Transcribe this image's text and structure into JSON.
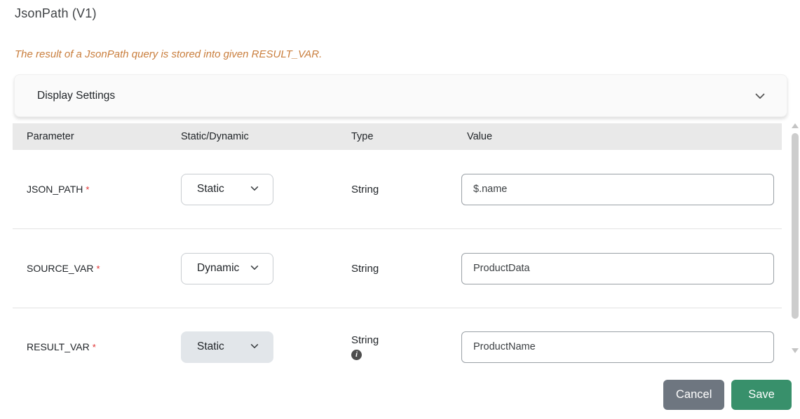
{
  "page": {
    "title": "JsonPath (V1)",
    "description": "The result of a JsonPath query is stored into given RESULT_VAR."
  },
  "display_settings": {
    "label": "Display Settings",
    "chevron_icon": "chevron-down"
  },
  "table": {
    "headers": {
      "parameter": "Parameter",
      "static_dynamic": "Static/Dynamic",
      "type": "Type",
      "value": "Value"
    },
    "rows": [
      {
        "parameter": "JSON_PATH",
        "required": "*",
        "static_dynamic": "Static",
        "type": "String",
        "value": "$.name"
      },
      {
        "parameter": "SOURCE_VAR",
        "required": "*",
        "static_dynamic": "Dynamic",
        "type": "String",
        "value": "ProductData"
      },
      {
        "parameter": "RESULT_VAR",
        "required": "*",
        "static_dynamic": "Static",
        "type": "String",
        "value": "ProductName",
        "info_icon": "info-circle"
      }
    ]
  },
  "footer": {
    "cancel_label": "Cancel",
    "save_label": "Save"
  },
  "colors": {
    "description_text": "#c97e3d",
    "table_header_bg": "#e9e9e9",
    "required_asterisk": "#e03131",
    "disabled_select_bg": "#e2e6ea",
    "cancel_button_bg": "#6e7680",
    "save_button_bg": "#38906b"
  }
}
